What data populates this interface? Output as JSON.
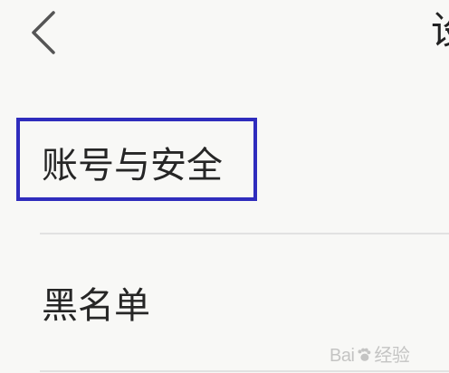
{
  "header": {
    "title": "设"
  },
  "menu": {
    "items": [
      {
        "label": "账号与安全"
      },
      {
        "label": "黑名单"
      }
    ]
  },
  "annotation": {
    "highlight_color": "#2f2cbd"
  },
  "watermark": {
    "text_left": "Bai",
    "text_right": "经验"
  },
  "icons": {
    "back": "chevron-left-icon",
    "watermark_logo": "paw-icon"
  },
  "colors": {
    "background": "#f8f8f6",
    "text": "#262626",
    "divider": "#e2e2e2"
  }
}
